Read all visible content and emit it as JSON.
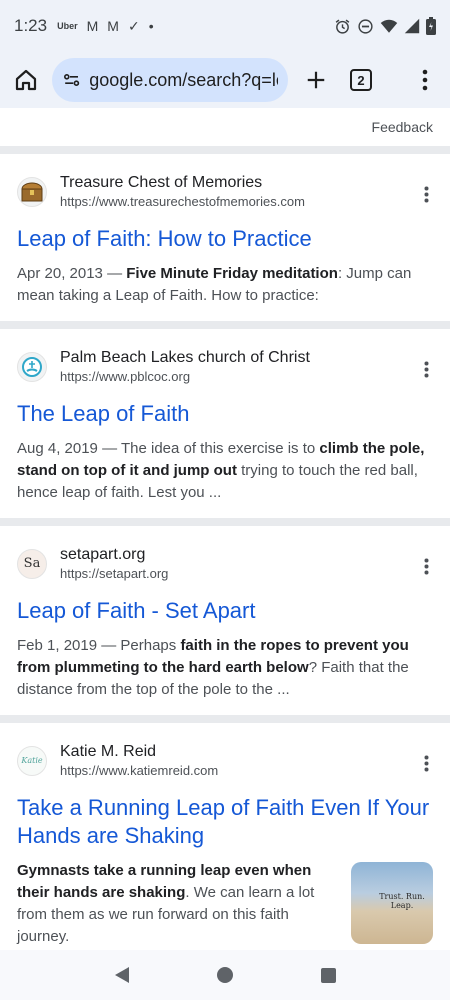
{
  "status_bar": {
    "time": "1:23",
    "notifications": [
      "Uber",
      "M",
      "M",
      "✓",
      "•"
    ]
  },
  "toolbar": {
    "url": "google.com/search?q=le",
    "tab_count": "2"
  },
  "feedback_label": "Feedback",
  "results": [
    {
      "site": "Treasure Chest of Memories",
      "url": "https://www.treasurechestofmemories.com",
      "title": "Leap of Faith: How to Practice",
      "snippet_parts": [
        {
          "t": "Apr 20, 2013 — ",
          "b": false
        },
        {
          "t": "Five Minute Friday meditation",
          "b": true
        },
        {
          "t": ": Jump can mean taking a Leap of Faith. How to practice:",
          "b": false
        }
      ]
    },
    {
      "site": "Palm Beach Lakes church of Christ",
      "url": "https://www.pblcoc.org",
      "title": "The Leap of Faith",
      "snippet_parts": [
        {
          "t": "Aug 4, 2019 — The idea of this exercise is to ",
          "b": false
        },
        {
          "t": "climb the pole, stand on top of it and jump out",
          "b": true
        },
        {
          "t": " trying to touch the red ball, hence leap of faith. Lest you ...",
          "b": false
        }
      ]
    },
    {
      "site": "setapart.org",
      "url": "https://setapart.org",
      "title": "Leap of Faith - Set Apart",
      "favicon_text": "Sa",
      "snippet_parts": [
        {
          "t": "Feb 1, 2019 — Perhaps ",
          "b": false
        },
        {
          "t": "faith in the ropes to prevent you from plummeting to the hard earth below",
          "b": true
        },
        {
          "t": "? Faith that the distance from the top of the pole to the ...",
          "b": false
        }
      ]
    },
    {
      "site": "Katie M. Reid",
      "url": "https://www.katiemreid.com",
      "title": "Take a Running Leap of Faith Even If Your Hands are Shaking",
      "favicon_text": "Katie",
      "thumb_text": "Trust. Run. Leap.",
      "snippet_parts": [
        {
          "t": "Gymnasts take a running leap even when their hands are shaking",
          "b": true
        },
        {
          "t": ". We can learn a lot from them as we run forward on this faith journey.",
          "b": false
        }
      ]
    }
  ]
}
